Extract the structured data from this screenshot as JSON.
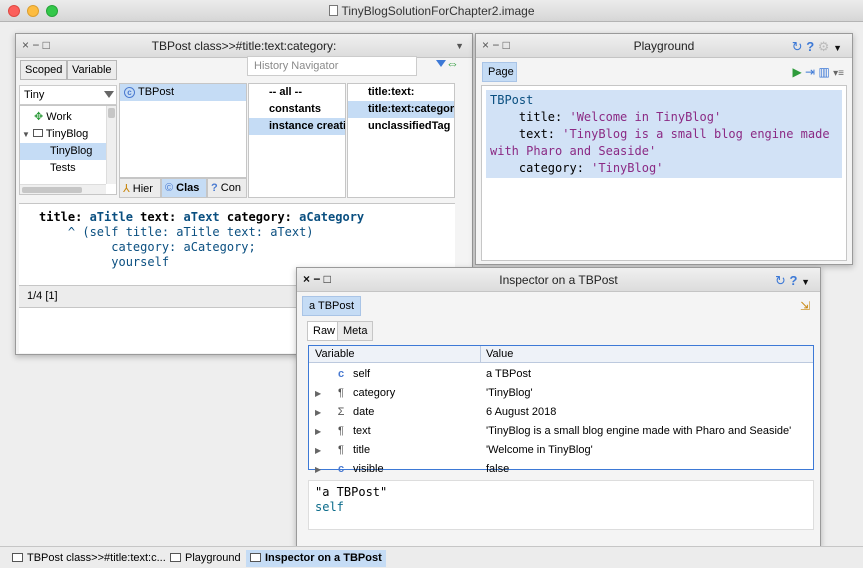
{
  "os": {
    "title": "TinyBlogSolutionForChapter2.image"
  },
  "browser": {
    "title": "TBPost class>>#title:text:category:",
    "controls": "× − □",
    "scoped_label": "Scoped",
    "variable_label": "Variable",
    "history_placeholder": "History Navigator",
    "package_filter": "Tiny",
    "packages": [
      "Work",
      "TinyBlog",
      "TinyBlog",
      "Tests"
    ],
    "classes": [
      "TBPost"
    ],
    "protocols": [
      "-- all --",
      "constants",
      "instance creation"
    ],
    "methods": [
      "title:text:",
      "title:text:category:",
      "unclassifiedTag"
    ],
    "tabs": [
      "Hier",
      "Clas",
      "Con"
    ],
    "code": {
      "line1_a": "title: ",
      "line1_b": "aTitle",
      "line1_c": " text: ",
      "line1_d": "aText",
      "line1_e": " category: ",
      "line1_f": "aCategory",
      "line2": "    ^ (self title: aTitle text: aText)",
      "line3": "          category: aCategory;",
      "line4": "          yourself"
    },
    "status": "1/4 [1]"
  },
  "playground": {
    "title": "Playground",
    "controls": "× − □",
    "page_tab": "Page",
    "code": {
      "l1": "TBPost",
      "l2a": "    title: ",
      "l2b": "'Welcome in TinyBlog'",
      "l3a": "    text: ",
      "l3b": "'TinyBlog is a small blog engine made with Pharo and Seaside'",
      "l4a": "    category: ",
      "l4b": "'TinyBlog'"
    }
  },
  "inspector": {
    "title": "Inspector on a TBPost",
    "controls": "× − □",
    "object_tab": "a TBPost",
    "raw_tab": "Raw",
    "meta_tab": "Meta",
    "col_variable": "Variable",
    "col_value": "Value",
    "rows": [
      {
        "expand": "",
        "kind": "c",
        "name": "self",
        "value": "a TBPost"
      },
      {
        "expand": "▶",
        "kind": "¶",
        "name": "category",
        "value": "'TinyBlog'"
      },
      {
        "expand": "▶",
        "kind": "Σ",
        "name": "date",
        "value": "6 August 2018"
      },
      {
        "expand": "▶",
        "kind": "¶",
        "name": "text",
        "value": "'TinyBlog is a small blog engine made with Pharo and Seaside'"
      },
      {
        "expand": "▶",
        "kind": "¶",
        "name": "title",
        "value": "'Welcome in TinyBlog'"
      },
      {
        "expand": "▶",
        "kind": "c",
        "name": "visible",
        "value": "false"
      }
    ],
    "eval_line1": "\"a TBPost\"",
    "eval_line2": "self"
  },
  "taskbar": {
    "items": [
      "TBPost class>>#title:text:c...",
      "Playground",
      "Inspector on a TBPost"
    ]
  },
  "colors": {
    "selection": "#c5dcf5",
    "accent": "#3d79d6",
    "string": "#8b2a84",
    "keyword": "#0a4f80"
  }
}
